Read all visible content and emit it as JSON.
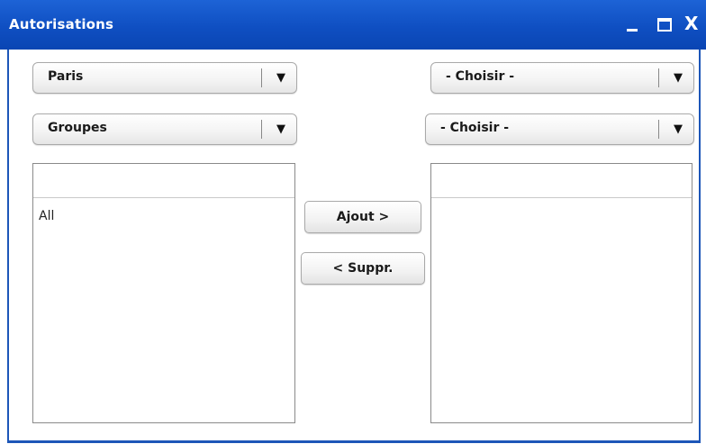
{
  "window": {
    "title": "Autorisations",
    "controls": {
      "minimize_icon": "minimize-icon",
      "maximize_icon": "maximize-icon",
      "close_icon": "close-icon",
      "close_glyph": "X"
    }
  },
  "left": {
    "location_select": {
      "value": "Paris"
    },
    "type_select": {
      "value": "Groupes"
    },
    "list": {
      "items": [
        "All"
      ]
    }
  },
  "right": {
    "select1": {
      "value": "- Choisir -"
    },
    "select2": {
      "value": "- Choisir -"
    },
    "list": {
      "items": []
    }
  },
  "actions": {
    "add_label": "Ajout >",
    "remove_label": "< Suppr."
  },
  "dropdown_arrow": "▼",
  "colors": {
    "titlebar": "#0f4fc2",
    "title_text": "#ffffff"
  }
}
